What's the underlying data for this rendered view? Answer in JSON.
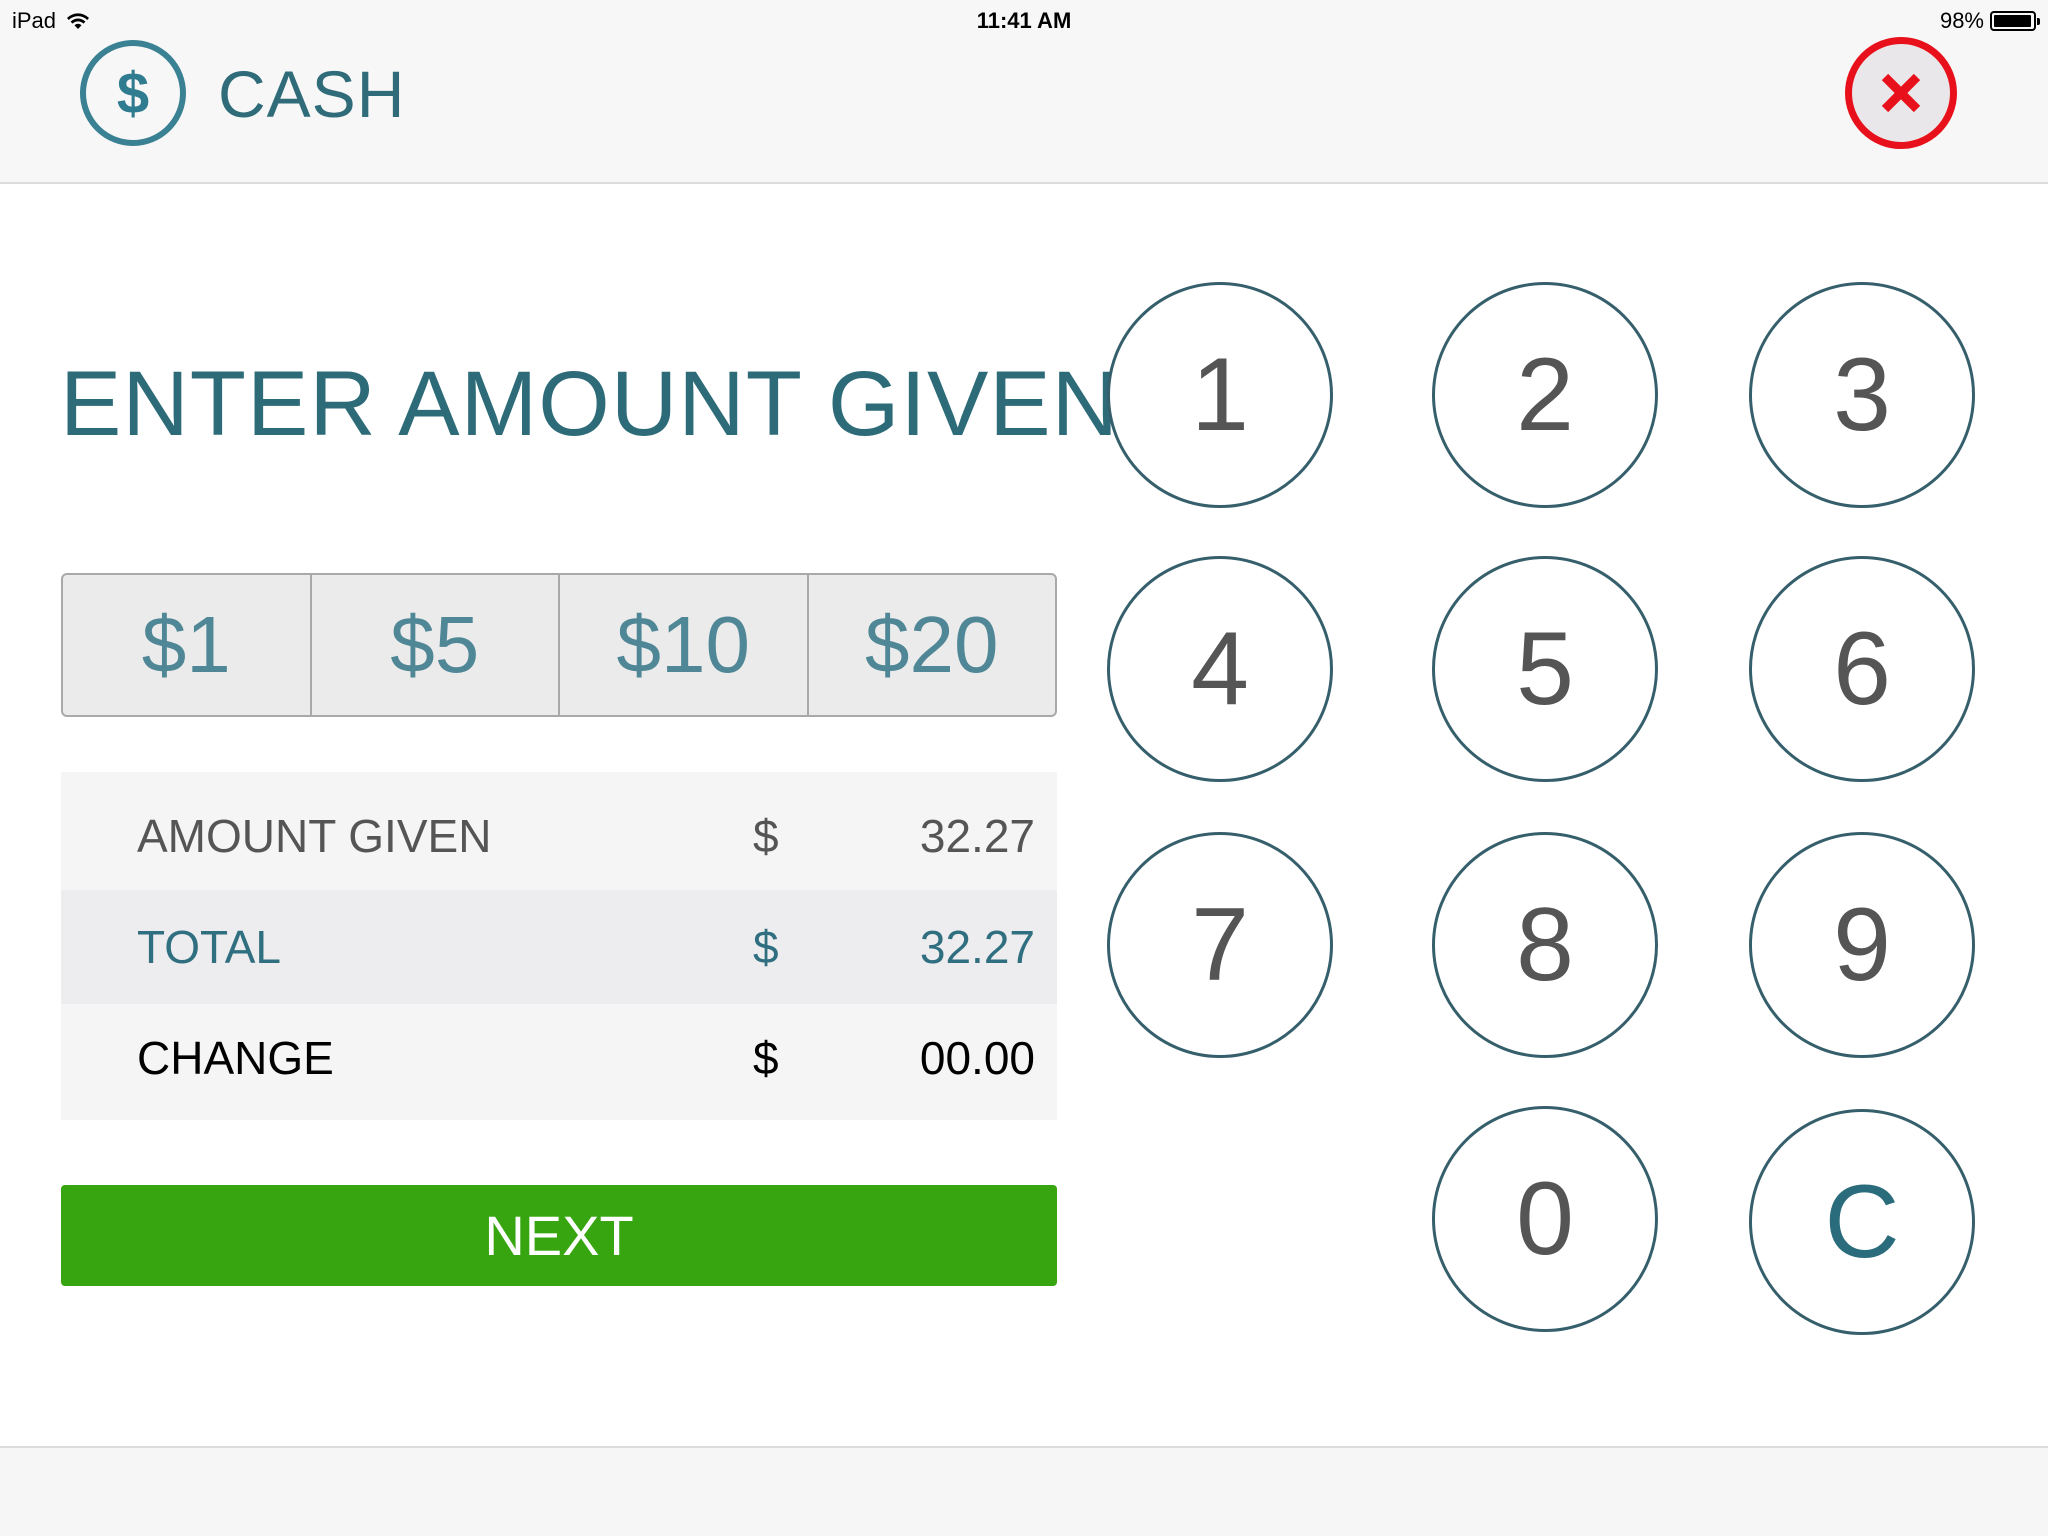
{
  "status_bar": {
    "device": "iPad",
    "time": "11:41 AM",
    "battery_percent": "98%",
    "battery_level": 0.98
  },
  "header": {
    "icon": "dollar-circle-icon",
    "icon_glyph": "$",
    "title": "CASH",
    "close_icon": "close-x-icon"
  },
  "main": {
    "title": "ENTER AMOUNT GIVEN",
    "presets": [
      {
        "label": "$1"
      },
      {
        "label": "$5"
      },
      {
        "label": "$10"
      },
      {
        "label": "$20"
      }
    ],
    "summary": {
      "amount_given": {
        "label": "AMOUNT GIVEN",
        "currency": "$",
        "value": "32.27"
      },
      "total": {
        "label": "TOTAL",
        "currency": "$",
        "value": "32.27"
      },
      "change": {
        "label": "CHANGE",
        "currency": "$",
        "value": "00.00"
      }
    },
    "next_label": "NEXT"
  },
  "keypad": {
    "keys": [
      "1",
      "2",
      "3",
      "4",
      "5",
      "6",
      "7",
      "8",
      "9",
      "0",
      "C"
    ]
  },
  "colors": {
    "accent": "#2f6b79",
    "close_red": "#e8101a",
    "next_green": "#37a50f",
    "key_border": "#365f6c"
  }
}
